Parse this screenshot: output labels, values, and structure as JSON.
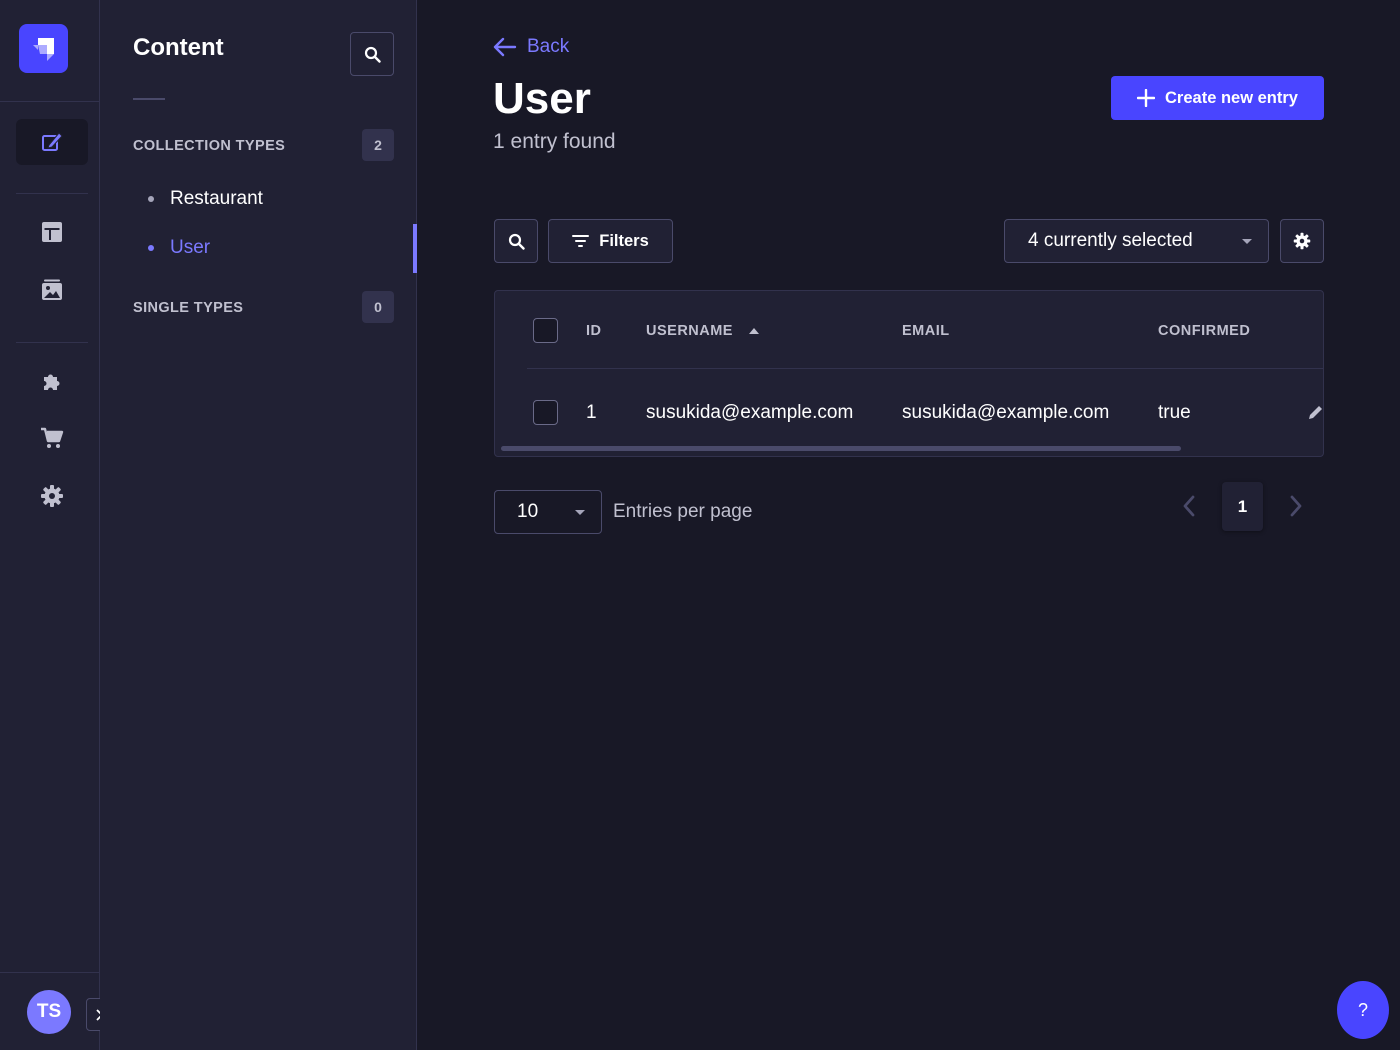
{
  "rail": {
    "avatar_initials": "TS",
    "icons": [
      "strapi-logo-icon",
      "content-manager-icon",
      "content-type-builder-icon",
      "media-library-icon",
      "plugins-icon",
      "marketplace-icon",
      "settings-icon"
    ]
  },
  "subnav": {
    "title": "Content",
    "collection_types": {
      "label": "COLLECTION TYPES",
      "count": "2",
      "items": [
        {
          "label": "Restaurant",
          "active": false
        },
        {
          "label": "User",
          "active": true
        }
      ]
    },
    "single_types": {
      "label": "SINGLE TYPES",
      "count": "0"
    }
  },
  "header": {
    "back_label": "Back",
    "title": "User",
    "subtitle": "1 entry found",
    "create_label": "Create new entry"
  },
  "toolbar": {
    "filters_label": "Filters",
    "columns_selected": "4 currently selected"
  },
  "table": {
    "headers": {
      "id": "ID",
      "username": "USERNAME",
      "email": "EMAIL",
      "confirmed": "CONFIRMED"
    },
    "sort": {
      "column": "username",
      "direction": "ascending"
    },
    "rows": [
      {
        "id": "1",
        "username": "susukida@example.com",
        "email": "susukida@example.com",
        "confirmed": "true"
      }
    ]
  },
  "pagination": {
    "page_size": "10",
    "page_size_label": "Entries per page",
    "current_page": "1"
  },
  "help": {
    "label": "?"
  },
  "colors": {
    "accent": "#4945ff",
    "accent_light": "#7b79ff",
    "background": "#181826",
    "surface": "#212134",
    "border": "#32324d"
  }
}
